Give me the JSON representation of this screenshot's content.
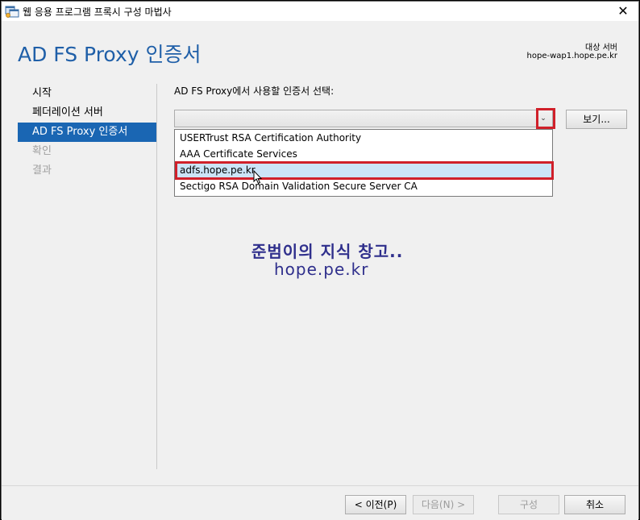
{
  "window": {
    "title": "웹 응용 프로그램 프록시 구성 마법사",
    "close_glyph": "✕"
  },
  "header": {
    "page_title": "AD FS Proxy 인증서",
    "dest_label": "대상 서버",
    "dest_server": "hope-wap1.hope.pe.kr"
  },
  "nav": {
    "items": [
      {
        "label": "시작",
        "state": "normal"
      },
      {
        "label": "페더레이션 서버",
        "state": "normal"
      },
      {
        "label": "AD FS Proxy 인증서",
        "state": "active"
      },
      {
        "label": "확인",
        "state": "disabled"
      },
      {
        "label": "결과",
        "state": "disabled"
      }
    ]
  },
  "content": {
    "prompt": "AD FS Proxy에서 사용할 인증서 선택:",
    "combo_arrow_glyph": "⌄",
    "view_button": "보기...",
    "certificates": [
      {
        "label": "USERTrust RSA Certification Authority",
        "selected": false
      },
      {
        "label": "AAA Certificate Services",
        "selected": false
      },
      {
        "label": "adfs.hope.pe.kr",
        "selected": true
      },
      {
        "label": "Sectigo RSA Domain Validation Secure Server CA",
        "selected": false
      }
    ]
  },
  "watermark": {
    "line1": "준범이의 지식 창고..",
    "line2": "hope.pe.kr"
  },
  "footer": {
    "prev": "< 이전(P)",
    "next": "다음(N) >",
    "configure": "구성",
    "cancel": "취소"
  },
  "colors": {
    "title_blue": "#1f5fa8",
    "nav_active": "#1a66b3",
    "highlight_red": "#d0202a",
    "selected_item": "#cce4f7"
  }
}
